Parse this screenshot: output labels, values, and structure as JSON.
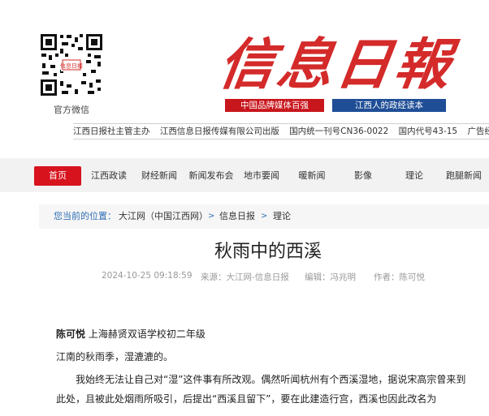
{
  "header": {
    "qr_caption": "官方微信",
    "masthead": "信息日報",
    "slogan_left": "中国品牌媒体百强",
    "slogan_right": "江西人的政经读本",
    "pubinfo": [
      "江西日报社主管主办",
      "江西信息日报传媒有限公司出版",
      "国内统一刊号CN36-0022",
      "国内代号43-15",
      "广告经"
    ]
  },
  "nav": {
    "items": [
      "首页",
      "江西政读",
      "财经新闻",
      "新闻发布会",
      "地市要闻",
      "暖新闻",
      "影像",
      "理论",
      "跑腿新闻"
    ],
    "active_index": 0
  },
  "breadcrumb": {
    "prefix": "您当前的位置：",
    "items": [
      "大江网（中国江西网）",
      "信息日报",
      "理论"
    ],
    "separator": ">"
  },
  "article": {
    "title": "秋雨中的西溪",
    "datetime": "2024-10-25 09:18:59",
    "source": "来源：大江网-信息日报",
    "editor": "编辑：冯兆明",
    "author": "作者：陈可悦",
    "author_name": "陈可悦",
    "author_school": "上海赫贤双语学校初二年级",
    "paragraphs": [
      "江南的秋雨季，湿漉漉的。",
      "我始终无法让自己对“湿”这件事有所改观。偶然听闻杭州有个西溪湿地，据说宋高宗曾来到此处，且被此处烟雨所吸引，后提出“西溪且留下”，要在此建造行宫，西溪也因此改名为"
    ]
  },
  "colors": {
    "brand_red": "#d7131d",
    "slogan_blue": "#1f4e96",
    "link_blue": "#2f6fb5"
  }
}
